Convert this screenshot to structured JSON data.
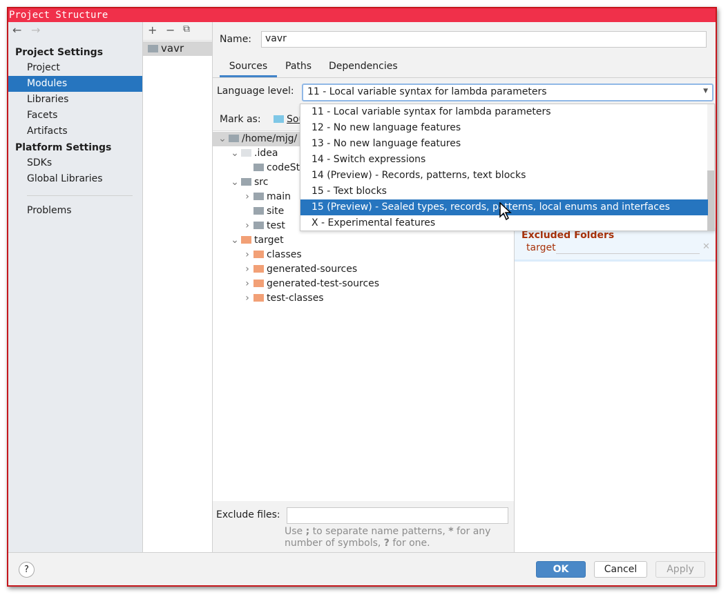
{
  "window": {
    "title": "Project Structure"
  },
  "nav": {
    "back": "←",
    "forward": "→"
  },
  "sidebar": {
    "project_settings": "Project Settings",
    "items": [
      "Project",
      "Modules",
      "Libraries",
      "Facets",
      "Artifacts"
    ],
    "platform_settings": "Platform Settings",
    "platform_items": [
      "SDKs",
      "Global Libraries"
    ],
    "problems": "Problems",
    "selected": "Modules"
  },
  "modules": {
    "toolbar": {
      "add": "+",
      "remove": "−",
      "copy": "⧉"
    },
    "items": [
      "vavr"
    ]
  },
  "main": {
    "name_label": "Name:",
    "name_value": "vavr",
    "tabs": [
      "Sources",
      "Paths",
      "Dependencies"
    ],
    "active_tab": "Sources",
    "language_label": "Language level:",
    "language_value": "11 - Local variable syntax for lambda parameters",
    "mark_as_label": "Mark as:",
    "mark_as_sources": "Sou",
    "options": [
      "11 - Local variable syntax for lambda parameters",
      "12 - No new language features",
      "13 - No new language features",
      "14 - Switch expressions",
      "14 (Preview) - Records, patterns, text blocks",
      "15 - Text blocks",
      "15 (Preview) - Sealed types, records, patterns, local enums and interfaces",
      "X - Experimental features"
    ],
    "highlighted_option": "15 (Preview) - Sealed types, records, patterns, local enums and interfaces",
    "tree": [
      {
        "label": "/home/mjg/",
        "indent": 0,
        "chev": "v",
        "type": "gray"
      },
      {
        "label": ".idea",
        "indent": 1,
        "chev": "v",
        "type": "light"
      },
      {
        "label": "codeSt",
        "indent": 2,
        "chev": "",
        "type": "gray"
      },
      {
        "label": "src",
        "indent": 1,
        "chev": "v",
        "type": "gray"
      },
      {
        "label": "main",
        "indent": 2,
        "chev": ">",
        "type": "gray"
      },
      {
        "label": "site",
        "indent": 2,
        "chev": "",
        "type": "gray"
      },
      {
        "label": "test",
        "indent": 2,
        "chev": ">",
        "type": "gray"
      },
      {
        "label": "target",
        "indent": 1,
        "chev": "v",
        "type": "orange"
      },
      {
        "label": "classes",
        "indent": 2,
        "chev": ">",
        "type": "orange"
      },
      {
        "label": "generated-sources",
        "indent": 2,
        "chev": ">",
        "type": "orange"
      },
      {
        "label": "generated-test-sources",
        "indent": 2,
        "chev": ">",
        "type": "orange"
      },
      {
        "label": "test-classes",
        "indent": 2,
        "chev": ">",
        "type": "orange"
      }
    ],
    "excluded_title": "Excluded Folders",
    "excluded_item": "target",
    "exclude_files_label": "Exclude files:",
    "exclude_files_value": "",
    "hint_1": "Use ",
    "hint_semi": ";",
    "hint_2": " to separate name patterns, ",
    "hint_star": "*",
    "hint_3": " for any",
    "hint_4": "number of symbols, ",
    "hint_q": "?",
    "hint_5": " for one."
  },
  "footer": {
    "help": "?",
    "ok": "OK",
    "cancel": "Cancel",
    "apply": "Apply"
  },
  "colors": {
    "title_bar": "#f0304a",
    "selection": "#2675bf",
    "excluded": "#a8320a"
  }
}
